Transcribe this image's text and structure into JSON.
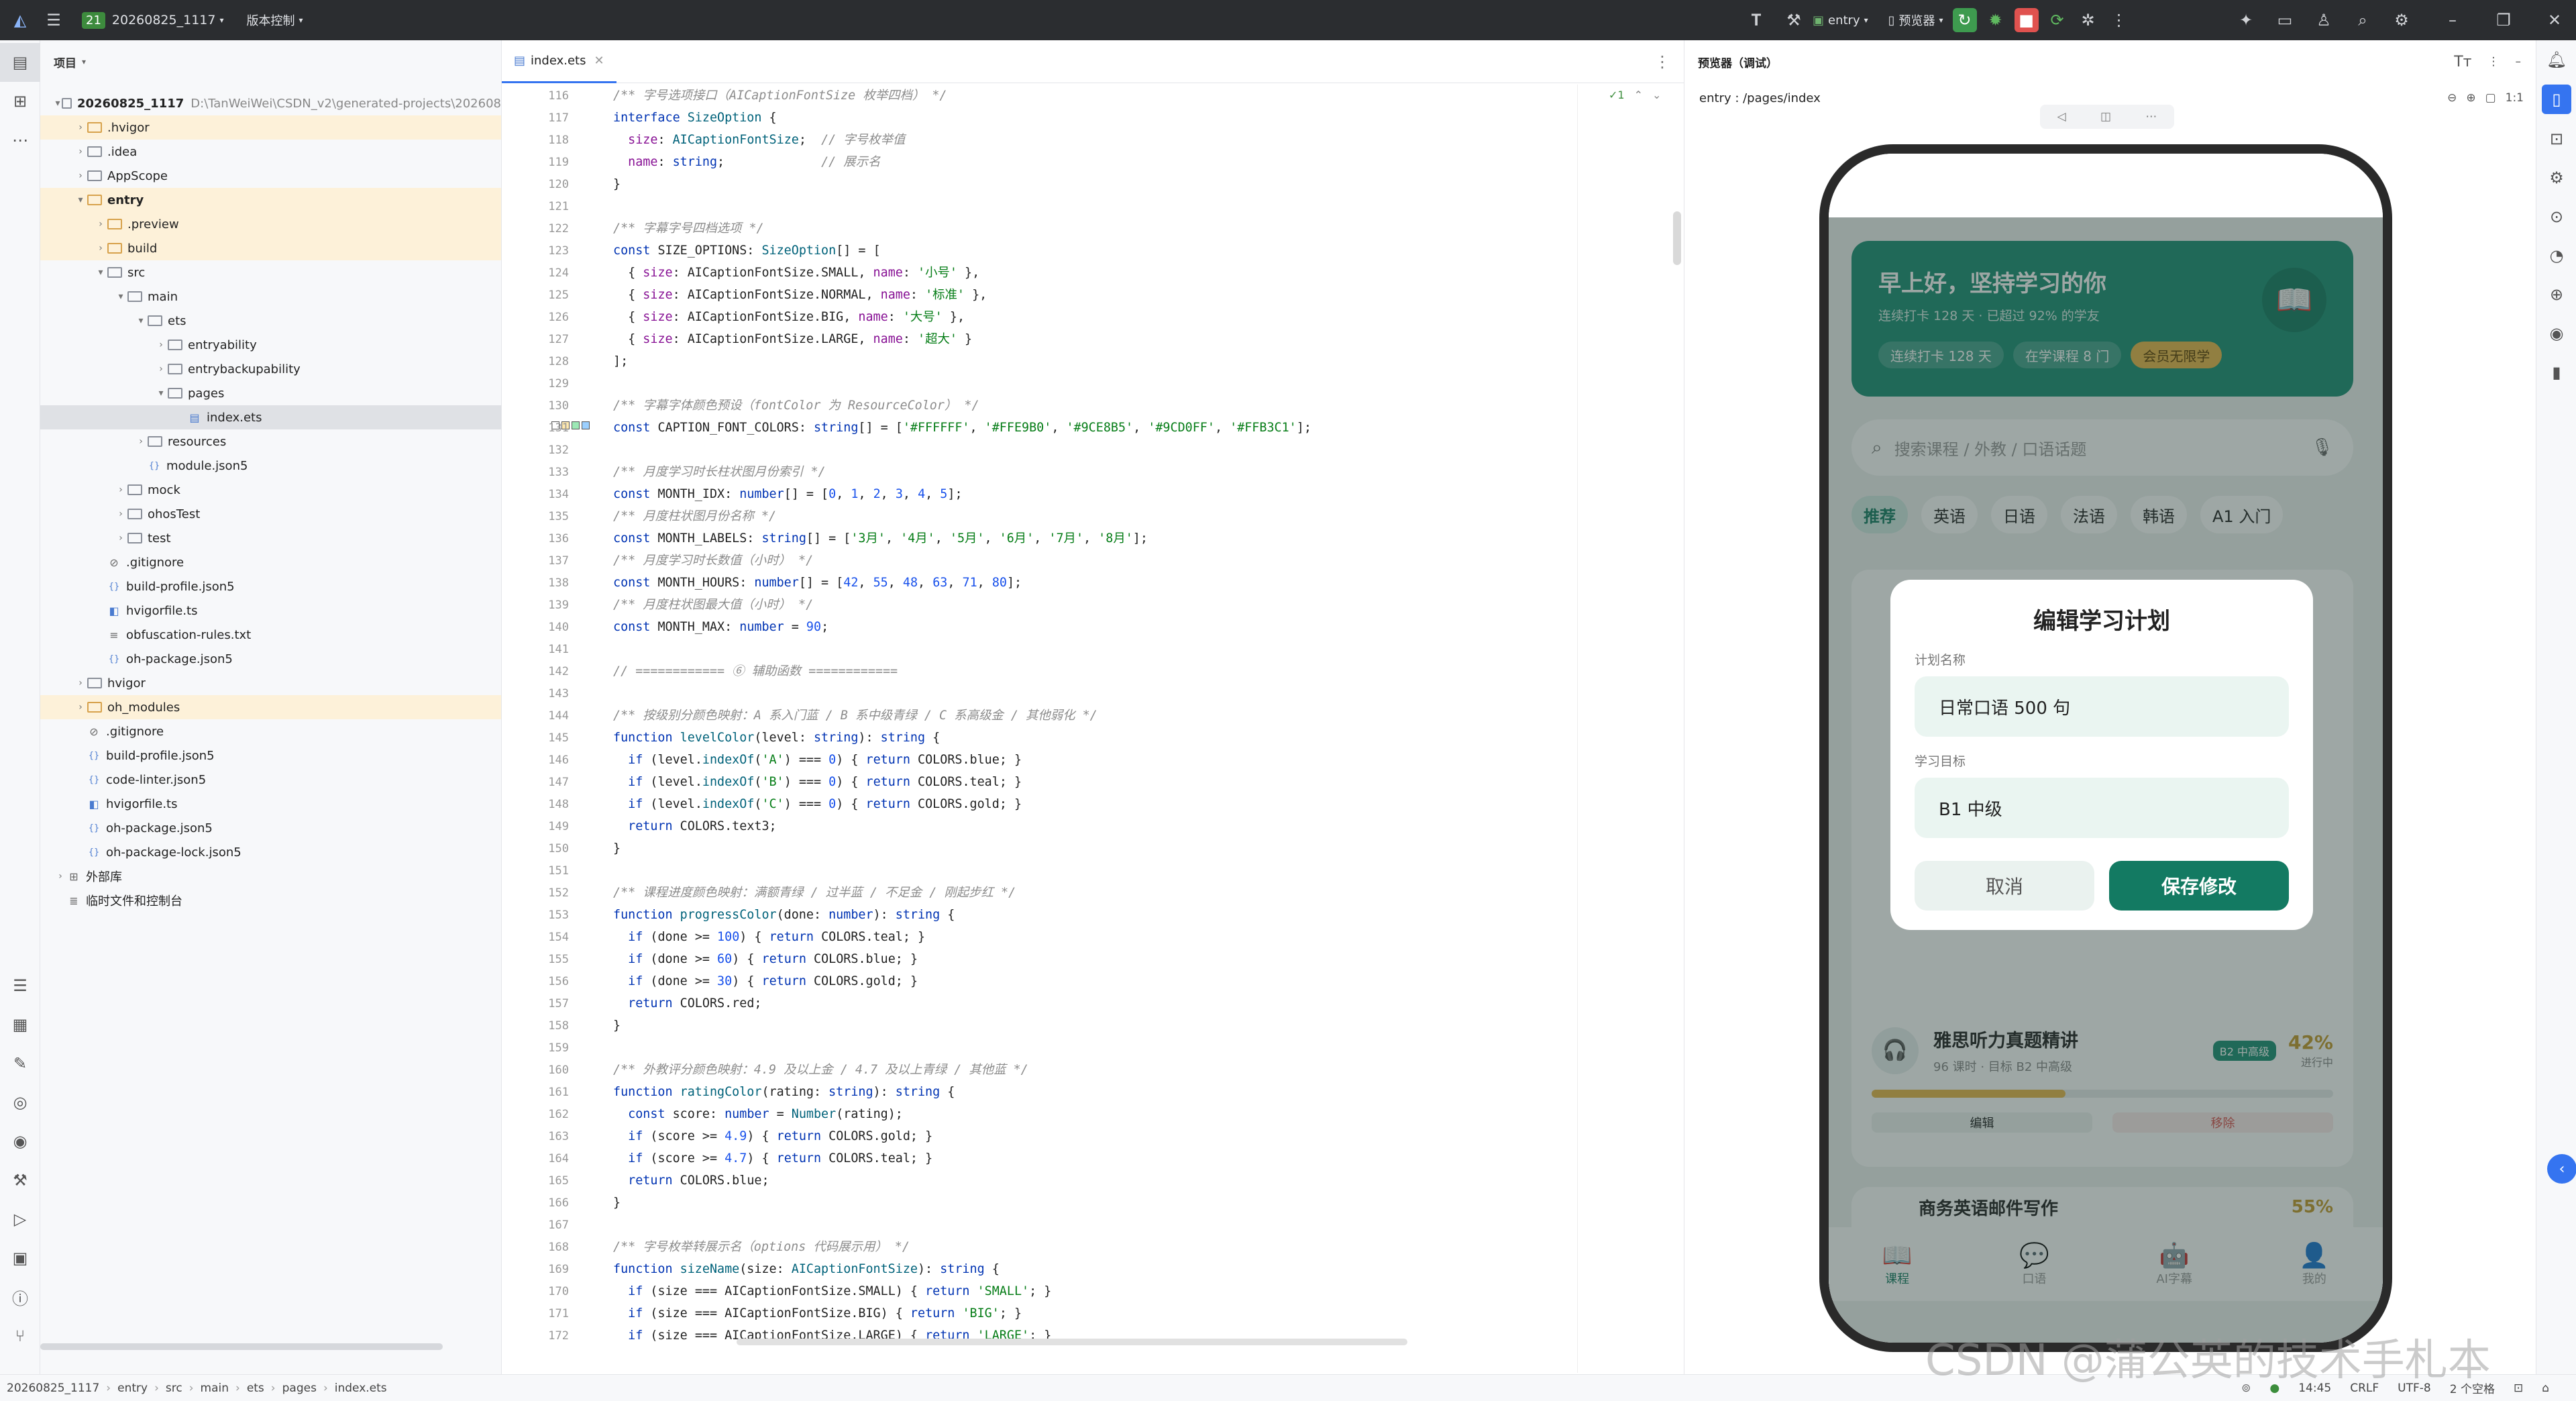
{
  "titlebar": {
    "project_badge": "21",
    "project_name": "20260825_1117",
    "vcs": "版本控制",
    "run_config": "entry",
    "device": "预览器"
  },
  "project_panel": {
    "title": "项目",
    "root_name": "20260825_1117",
    "root_path": "D:\\TanWeiWei\\CSDN_v2\\generated-projects\\202608",
    "items": [
      {
        "label": ".hvigor",
        "depth": 1,
        "kind": "folder-yellow",
        "expand": "closed",
        "hl": true
      },
      {
        "label": ".idea",
        "depth": 1,
        "kind": "folder",
        "expand": "closed"
      },
      {
        "label": "AppScope",
        "depth": 1,
        "kind": "folder",
        "expand": "closed"
      },
      {
        "label": "entry",
        "depth": 1,
        "kind": "folder-yellow",
        "expand": "open",
        "hl": true,
        "bold": true
      },
      {
        "label": ".preview",
        "depth": 2,
        "kind": "folder-yellow",
        "expand": "closed",
        "hl": true
      },
      {
        "label": "build",
        "depth": 2,
        "kind": "folder-yellow",
        "expand": "closed",
        "hl": true
      },
      {
        "label": "src",
        "depth": 2,
        "kind": "folder",
        "expand": "open"
      },
      {
        "label": "main",
        "depth": 3,
        "kind": "folder",
        "expand": "open"
      },
      {
        "label": "ets",
        "depth": 4,
        "kind": "folder",
        "expand": "open"
      },
      {
        "label": "entryability",
        "depth": 5,
        "kind": "folder",
        "expand": "closed"
      },
      {
        "label": "entrybackupability",
        "depth": 5,
        "kind": "folder",
        "expand": "closed"
      },
      {
        "label": "pages",
        "depth": 5,
        "kind": "folder",
        "expand": "open"
      },
      {
        "label": "index.ets",
        "depth": 6,
        "kind": "file",
        "expand": "none",
        "sel": true
      },
      {
        "label": "resources",
        "depth": 4,
        "kind": "folder",
        "expand": "closed"
      },
      {
        "label": "module.json5",
        "depth": 4,
        "kind": "json",
        "expand": "none"
      },
      {
        "label": "mock",
        "depth": 3,
        "kind": "folder",
        "expand": "closed"
      },
      {
        "label": "ohosTest",
        "depth": 3,
        "kind": "folder",
        "expand": "closed"
      },
      {
        "label": "test",
        "depth": 3,
        "kind": "folder",
        "expand": "closed"
      },
      {
        "label": ".gitignore",
        "depth": 2,
        "kind": "ignore",
        "expand": "none"
      },
      {
        "label": "build-profile.json5",
        "depth": 2,
        "kind": "json",
        "expand": "none"
      },
      {
        "label": "hvigorfile.ts",
        "depth": 2,
        "kind": "ts",
        "expand": "none"
      },
      {
        "label": "obfuscation-rules.txt",
        "depth": 2,
        "kind": "txt",
        "expand": "none"
      },
      {
        "label": "oh-package.json5",
        "depth": 2,
        "kind": "json",
        "expand": "none"
      },
      {
        "label": "hvigor",
        "depth": 1,
        "kind": "folder",
        "expand": "closed"
      },
      {
        "label": "oh_modules",
        "depth": 1,
        "kind": "folder-yellow",
        "expand": "closed",
        "hl": true
      },
      {
        "label": ".gitignore",
        "depth": 1,
        "kind": "ignore",
        "expand": "none"
      },
      {
        "label": "build-profile.json5",
        "depth": 1,
        "kind": "json",
        "expand": "none"
      },
      {
        "label": "code-linter.json5",
        "depth": 1,
        "kind": "json",
        "expand": "none"
      },
      {
        "label": "hvigorfile.ts",
        "depth": 1,
        "kind": "ts",
        "expand": "none"
      },
      {
        "label": "oh-package.json5",
        "depth": 1,
        "kind": "json",
        "expand": "none"
      },
      {
        "label": "oh-package-lock.json5",
        "depth": 1,
        "kind": "json",
        "expand": "none"
      },
      {
        "label": "外部库",
        "depth": 0,
        "kind": "lib",
        "expand": "closed"
      },
      {
        "label": "临时文件和控制台",
        "depth": 0,
        "kind": "scratch",
        "expand": "none"
      }
    ]
  },
  "editor": {
    "tab_label": "index.ets",
    "inspection": "✓1",
    "lines": [
      {
        "n": "116",
        "html": "<span class='cm'>/** 字号选项接口（AICaptionFontSize 枚举四档） */</span>"
      },
      {
        "n": "117",
        "html": "<span class='kw'>interface</span> <span class='ty'>SizeOption</span> {"
      },
      {
        "n": "118",
        "html": "  <span class='pr'>size</span>: <span class='ty'>AICaptionFontSize</span>;  <span class='cm'>// 字号枚举值</span>"
      },
      {
        "n": "119",
        "html": "  <span class='pr'>name</span>: <span class='kw'>string</span>;             <span class='cm'>// 展示名</span>"
      },
      {
        "n": "120",
        "html": "}"
      },
      {
        "n": "121",
        "html": ""
      },
      {
        "n": "122",
        "html": "<span class='cm'>/** 字幕字号四档选项 */</span>"
      },
      {
        "n": "123",
        "html": "<span class='kw'>const</span> SIZE_OPTIONS: <span class='ty'>SizeOption</span>[] = ["
      },
      {
        "n": "124",
        "html": "  { <span class='pr'>size</span>: AICaptionFontSize.SMALL, <span class='pr'>name</span>: <span class='st'>'小号'</span> },"
      },
      {
        "n": "125",
        "html": "  { <span class='pr'>size</span>: AICaptionFontSize.NORMAL, <span class='pr'>name</span>: <span class='st'>'标准'</span> },"
      },
      {
        "n": "126",
        "html": "  { <span class='pr'>size</span>: AICaptionFontSize.BIG, <span class='pr'>name</span>: <span class='st'>'大号'</span> },"
      },
      {
        "n": "127",
        "html": "  { <span class='pr'>size</span>: AICaptionFontSize.LARGE, <span class='pr'>name</span>: <span class='st'>'超大'</span> }"
      },
      {
        "n": "128",
        "html": "];"
      },
      {
        "n": "129",
        "html": ""
      },
      {
        "n": "130",
        "html": "<span class='cm'>/** 字幕字体颜色预设（fontColor 为 ResourceColor） */</span>"
      },
      {
        "n": "131",
        "html": "<span class='kw'>const</span> CAPTION_FONT_COLORS: <span class='kw'>string</span>[] = [<span class='st'>'#FFFFFF'</span>, <span class='st'>'#FFE9B0'</span>, <span class='st'>'#9CE8B5'</span>, <span class='st'>'#9CD0FF'</span>, <span class='st'>'#FFB3C1'</span>];"
      },
      {
        "n": "132",
        "html": ""
      },
      {
        "n": "133",
        "html": "<span class='cm'>/** 月度学习时长柱状图月份索引 */</span>"
      },
      {
        "n": "134",
        "html": "<span class='kw'>const</span> MONTH_IDX: <span class='kw'>number</span>[] = [<span class='nu'>0</span>, <span class='nu'>1</span>, <span class='nu'>2</span>, <span class='nu'>3</span>, <span class='nu'>4</span>, <span class='nu'>5</span>];"
      },
      {
        "n": "135",
        "html": "<span class='cm'>/** 月度柱状图月份名称 */</span>"
      },
      {
        "n": "136",
        "html": "<span class='kw'>const</span> MONTH_LABELS: <span class='kw'>string</span>[] = [<span class='st'>'3月'</span>, <span class='st'>'4月'</span>, <span class='st'>'5月'</span>, <span class='st'>'6月'</span>, <span class='st'>'7月'</span>, <span class='st'>'8月'</span>];"
      },
      {
        "n": "137",
        "html": "<span class='cm'>/** 月度学习时长数值（小时） */</span>"
      },
      {
        "n": "138",
        "html": "<span class='kw'>const</span> MONTH_HOURS: <span class='kw'>number</span>[] = [<span class='nu'>42</span>, <span class='nu'>55</span>, <span class='nu'>48</span>, <span class='nu'>63</span>, <span class='nu'>71</span>, <span class='nu'>80</span>];"
      },
      {
        "n": "139",
        "html": "<span class='cm'>/** 月度柱状图最大值（小时） */</span>"
      },
      {
        "n": "140",
        "html": "<span class='kw'>const</span> MONTH_MAX: <span class='kw'>number</span> = <span class='nu'>90</span>;"
      },
      {
        "n": "141",
        "html": ""
      },
      {
        "n": "142",
        "html": "<span class='cm'>// ============ ⑥ 辅助函数 ============</span>"
      },
      {
        "n": "143",
        "html": ""
      },
      {
        "n": "144",
        "html": "<span class='cm'>/** 按级别分颜色映射：A 系入门蓝 / B 系中级青绿 / C 系高级金 / 其他弱化 */</span>"
      },
      {
        "n": "145",
        "html": "<span class='kw'>function</span> <span class='fn'>levelColor</span>(level: <span class='kw'>string</span>): <span class='kw'>string</span> {"
      },
      {
        "n": "146",
        "html": "  <span class='kw'>if</span> (level.<span class='fn'>indexOf</span>(<span class='st'>'A'</span>) === <span class='nu'>0</span>) { <span class='kw'>return</span> COLORS.blue; }"
      },
      {
        "n": "147",
        "html": "  <span class='kw'>if</span> (level.<span class='fn'>indexOf</span>(<span class='st'>'B'</span>) === <span class='nu'>0</span>) { <span class='kw'>return</span> COLORS.teal; }"
      },
      {
        "n": "148",
        "html": "  <span class='kw'>if</span> (level.<span class='fn'>indexOf</span>(<span class='st'>'C'</span>) === <span class='nu'>0</span>) { <span class='kw'>return</span> COLORS.gold; }"
      },
      {
        "n": "149",
        "html": "  <span class='kw'>return</span> COLORS.text3;"
      },
      {
        "n": "150",
        "html": "}"
      },
      {
        "n": "151",
        "html": ""
      },
      {
        "n": "152",
        "html": "<span class='cm'>/** 课程进度颜色映射：满额青绿 / 过半蓝 / 不足金 / 刚起步红 */</span>"
      },
      {
        "n": "153",
        "html": "<span class='kw'>function</span> <span class='fn'>progressColor</span>(done: <span class='kw'>number</span>): <span class='kw'>string</span> {"
      },
      {
        "n": "154",
        "html": "  <span class='kw'>if</span> (done >= <span class='nu'>100</span>) { <span class='kw'>return</span> COLORS.teal; }"
      },
      {
        "n": "155",
        "html": "  <span class='kw'>if</span> (done >= <span class='nu'>60</span>) { <span class='kw'>return</span> COLORS.blue; }"
      },
      {
        "n": "156",
        "html": "  <span class='kw'>if</span> (done >= <span class='nu'>30</span>) { <span class='kw'>return</span> COLORS.gold; }"
      },
      {
        "n": "157",
        "html": "  <span class='kw'>return</span> COLORS.red;"
      },
      {
        "n": "158",
        "html": "}"
      },
      {
        "n": "159",
        "html": ""
      },
      {
        "n": "160",
        "html": "<span class='cm'>/** 外教评分颜色映射：4.9 及以上金 / 4.7 及以上青绿 / 其他蓝 */</span>"
      },
      {
        "n": "161",
        "html": "<span class='kw'>function</span> <span class='fn'>ratingColor</span>(rating: <span class='kw'>string</span>): <span class='kw'>string</span> {"
      },
      {
        "n": "162",
        "html": "  <span class='kw'>const</span> score: <span class='kw'>number</span> = <span class='fn'>Number</span>(rating);"
      },
      {
        "n": "163",
        "html": "  <span class='kw'>if</span> (score >= <span class='nu'>4.9</span>) { <span class='kw'>return</span> COLORS.gold; }"
      },
      {
        "n": "164",
        "html": "  <span class='kw'>if</span> (score >= <span class='nu'>4.7</span>) { <span class='kw'>return</span> COLORS.teal; }"
      },
      {
        "n": "165",
        "html": "  <span class='kw'>return</span> COLORS.blue;"
      },
      {
        "n": "166",
        "html": "}"
      },
      {
        "n": "167",
        "html": ""
      },
      {
        "n": "168",
        "html": "<span class='cm'>/** 字号枚举转展示名（options 代码展示用） */</span>"
      },
      {
        "n": "169",
        "html": "<span class='kw'>function</span> <span class='fn'>sizeName</span>(size: <span class='ty'>AICaptionFontSize</span>): <span class='kw'>string</span> {"
      },
      {
        "n": "170",
        "html": "  <span class='kw'>if</span> (size === AICaptionFontSize.SMALL) { <span class='kw'>return</span> <span class='st'>'SMALL'</span>; }"
      },
      {
        "n": "171",
        "html": "  <span class='kw'>if</span> (size === AICaptionFontSize.BIG) { <span class='kw'>return</span> <span class='st'>'BIG'</span>; }"
      },
      {
        "n": "172",
        "html": "  <span class='kw'>if</span> (size === AICaptionFontSize.LARGE) { <span class='kw'>return</span> <span class='st'>'LARGE'</span>; }"
      }
    ]
  },
  "preview": {
    "title": "预览器（调试）",
    "route": "entry : /pages/index"
  },
  "app": {
    "greeting": "早上好，坚持学习的你",
    "subtitle": "连续打卡 128 天 · 已超过 92% 的学友",
    "chips": [
      "连续打卡 128 天",
      "在学课程 8 门",
      "会员无限学"
    ],
    "search_placeholder": "搜索课程 / 外教 / 口语话题",
    "categories": [
      "推荐",
      "英语",
      "日语",
      "法语",
      "韩语",
      "A1 入门"
    ],
    "course_title": "雅思听力真题精讲",
    "course_meta": "96 课时 · 目标 B2 中高级",
    "course_level": "B2 中高级",
    "course_percent": "42%",
    "course_state": "进行中",
    "course_progress": 0.42,
    "edit_label": "编辑",
    "remove_label": "移除",
    "next_course_title": "商务英语邮件写作",
    "next_percent": "55%",
    "bottom_nav": [
      "课程",
      "口语",
      "AI字幕",
      "我的"
    ]
  },
  "dialog": {
    "title": "编辑学习计划",
    "name_label": "计划名称",
    "name_value": "日常口语 500 句",
    "goal_label": "学习目标",
    "goal_value": "B1 中级",
    "cancel": "取消",
    "save": "保存修改"
  },
  "statusbar": {
    "crumbs": [
      "20260825_1117",
      "entry",
      "src",
      "main",
      "ets",
      "pages",
      "index.ets"
    ],
    "time": "14:45",
    "eol": "CRLF",
    "encoding": "UTF-8",
    "indent": "2 个空格"
  },
  "watermark": "CSDN @蒲公英的技术手札本"
}
